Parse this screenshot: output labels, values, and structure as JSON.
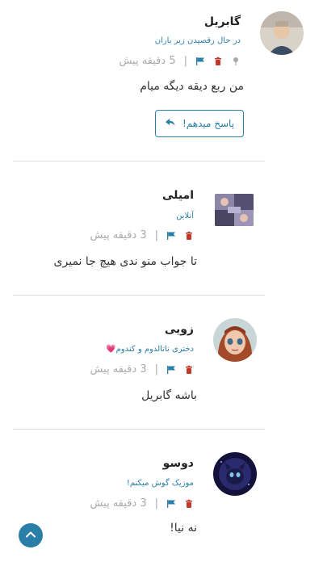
{
  "comments": [
    {
      "name": "گابریل",
      "status": "در حال رقصیدن زیر باران",
      "time_label": "5 دقیقه پیش",
      "separator": "|",
      "text": "من ربع دیقه دیگه میام",
      "reply_label": "پاسخ میدهم!"
    },
    {
      "name": "امیلی",
      "status": "آنلاین",
      "time_label": "3 دقیقه پیش",
      "separator": "|",
      "text": "تا جواب منو ندی هیچ جا نمیری"
    },
    {
      "name": "زویی",
      "status": "دختری ناتالدوم و کندوم💗",
      "time_label": "3 دقیقه پیش",
      "separator": "|",
      "text": "باشه گابریل"
    },
    {
      "name": "دوسو",
      "status": "موزیک گوش میکنم!",
      "time_label": "3 دقیقه پیش",
      "separator": "|",
      "text": "نه نیا!"
    }
  ],
  "colors": {
    "accent": "#2a7fa8",
    "delete": "#c0392b",
    "muted": "#aaaaaa"
  },
  "icons": {
    "pin": "pin-icon",
    "delete": "trash-icon",
    "flag": "flag-icon",
    "reply": "reply-arrow-icon",
    "scroll_top": "chevron-up-icon"
  }
}
